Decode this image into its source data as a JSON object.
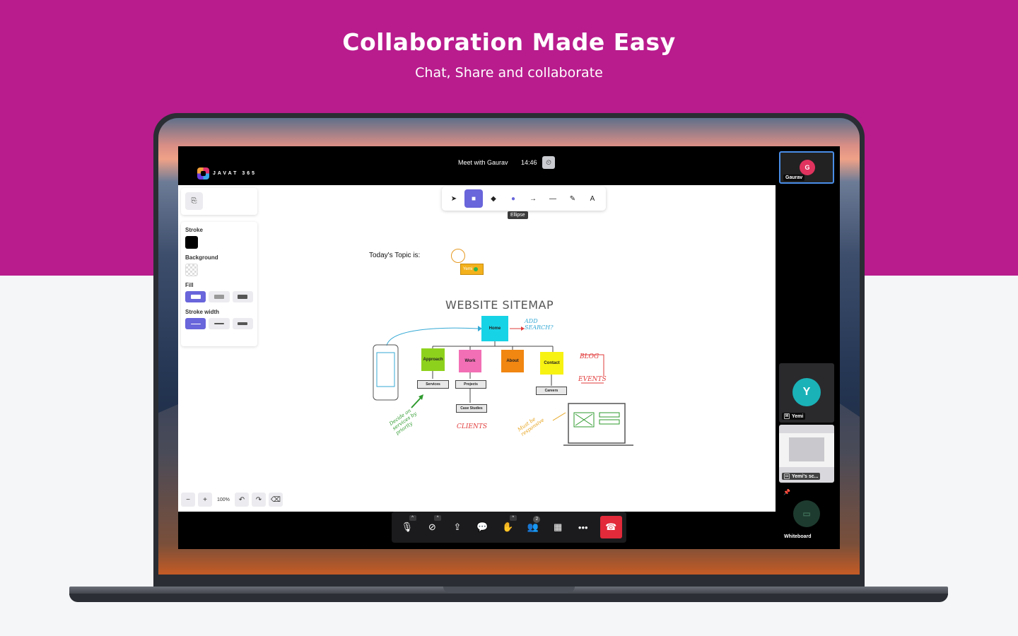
{
  "hero": {
    "title": "Collaboration Made Easy",
    "subtitle": "Chat, Share and collaborate"
  },
  "app": {
    "logo": "JAVAT 365",
    "meeting": {
      "title": "Meet with Gaurav",
      "time": "14:46"
    },
    "toolbar": {
      "tools": [
        "select-icon",
        "rectangle-icon",
        "diamond-icon",
        "ellipse-icon",
        "arrow-icon",
        "line-icon",
        "pencil-icon",
        "text-icon"
      ],
      "text_tool_label": "A",
      "tooltip": "Ellipse"
    },
    "properties": {
      "stroke_label": "Stroke",
      "background_label": "Background",
      "fill_label": "Fill",
      "stroke_width_label": "Stroke width"
    },
    "canvas": {
      "topic": "Today's Topic is:",
      "cursor_user": "Yemi",
      "sitemap_title": "WEBSITE SITEMAP",
      "pages": [
        "Home",
        "Approach",
        "Work",
        "About",
        "Contact"
      ],
      "subpages": [
        "Services",
        "Projects",
        "Case Studies",
        "Careers"
      ],
      "notes": [
        "ADD SEARCH?",
        "BLOG",
        "EVENTS",
        "CLIENTS",
        "Decide on services by priority",
        "Must be responsive"
      ]
    },
    "zoom": {
      "value": "100%"
    },
    "controls": {
      "participants_count": "2"
    },
    "participants": [
      {
        "initial": "G",
        "name": "Gaurav",
        "color": "#e0335e"
      },
      {
        "initial": "Y",
        "name": "Yemi",
        "color": "#1ab2b7"
      },
      {
        "name": "Yemi's sc..."
      },
      {
        "name": "Whiteboard"
      }
    ],
    "colors": {
      "accent": "#6965db",
      "hero": "#b81c8d",
      "end_call": "#e22a3a"
    }
  }
}
